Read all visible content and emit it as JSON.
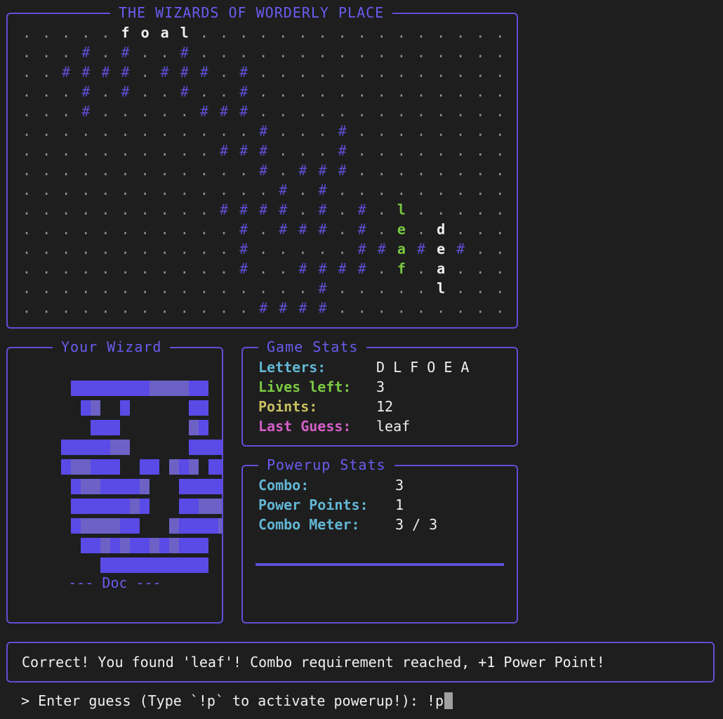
{
  "app": {
    "title": "THE WIZARDS OF WORDERLY PLACE",
    "accent": "#5f4fd6",
    "colors": {
      "wall": "#5f4fd6",
      "dot": "#9a9a9a",
      "found": "#7ac943",
      "letter": "#f2f2f2"
    }
  },
  "board": {
    "rows": [
      ". . . . . f o a l . . . . . . . . . . . . . . . . .",
      ". . . # . # . . # . . . . . . . . . . . . . . . . .",
      ". . # # # # . # # # . # . . . . . . . . . . . . . .",
      ". . . # . # . . # . . # . . . . . . . . . . . . . .",
      ". . . # . . . . . # # # . . . . . . . . . . . . . .",
      ". . . . . . . . . . . . # . . . # . . . . . . . . .",
      ". . . . . . . . . . # # # . . . # . . . . . . . . .",
      ". . . . . . . . . . . . # . # # # . . . . . . . . .",
      ". . . . . . . . . . . . . # . # . . . . . . . . . .",
      ". . . . . . . . . . # # # # . # . # . l . . . . . .",
      ". . . . . . . . . . . # . # # # . # . e . d . . . .",
      ". . . . . . . . . . . # . . . . . # # a # e # . . .",
      ". . . . . . . . . . . # . . # # # # . f . a . . . .",
      ". . . . . . . . . . . . . . . # . . . . . l . . . .",
      ". . . . . . . . . . . . # # # # . . . . . . . . . ."
    ],
    "found_words": [
      "leaf"
    ],
    "found_word_column": 19,
    "found_word_start_row": 9
  },
  "wizard": {
    "title": "Your Wizard",
    "name_label": "--- Doc ---",
    "colors": {
      "solid": "#5a4ae6",
      "shade": "#8878ff"
    },
    "art_rows": [
      "    ########%%%%##   ",
      "     #%  #      ##   ",
      "      ###       %#   ",
      "   #####%%      #### ",
      "   #%%###  ## %#% ###",
      "    #%%####%   ##### ",
      "    ######%#   ##%%% ",
      "    #%%%%##   %####% ",
      "     ##%#%##%#%###   ",
      "       ###########   "
    ]
  },
  "game_stats": {
    "title": "Game Stats",
    "letters_label": "Letters:",
    "letters_value": "D L F O E A",
    "lives_label": "Lives left:",
    "lives_value": "3",
    "points_label": "Points:",
    "points_value": "12",
    "last_guess_label": "Last Guess:",
    "last_guess_value": "leaf",
    "label_colors": {
      "letters": "#62b6d4",
      "lives": "#7ac943",
      "points": "#c8c060",
      "last_guess": "#d45fc8"
    }
  },
  "powerup_stats": {
    "title": "Powerup Stats",
    "combo_label": "Combo:",
    "combo_value": "3",
    "power_points_label": "Power Points:",
    "power_points_value": "1",
    "combo_meter_label": "Combo Meter:",
    "combo_meter_value": "3 / 3",
    "combo_meter_fill": 1.0,
    "label_color": "#62b6d4"
  },
  "message": {
    "text": "Correct! You found 'leaf'! Combo requirement reached, +1 Power Point!"
  },
  "input": {
    "prompt": "> Enter guess (Type `!p` to activate powerup!): ",
    "value": "!p"
  }
}
